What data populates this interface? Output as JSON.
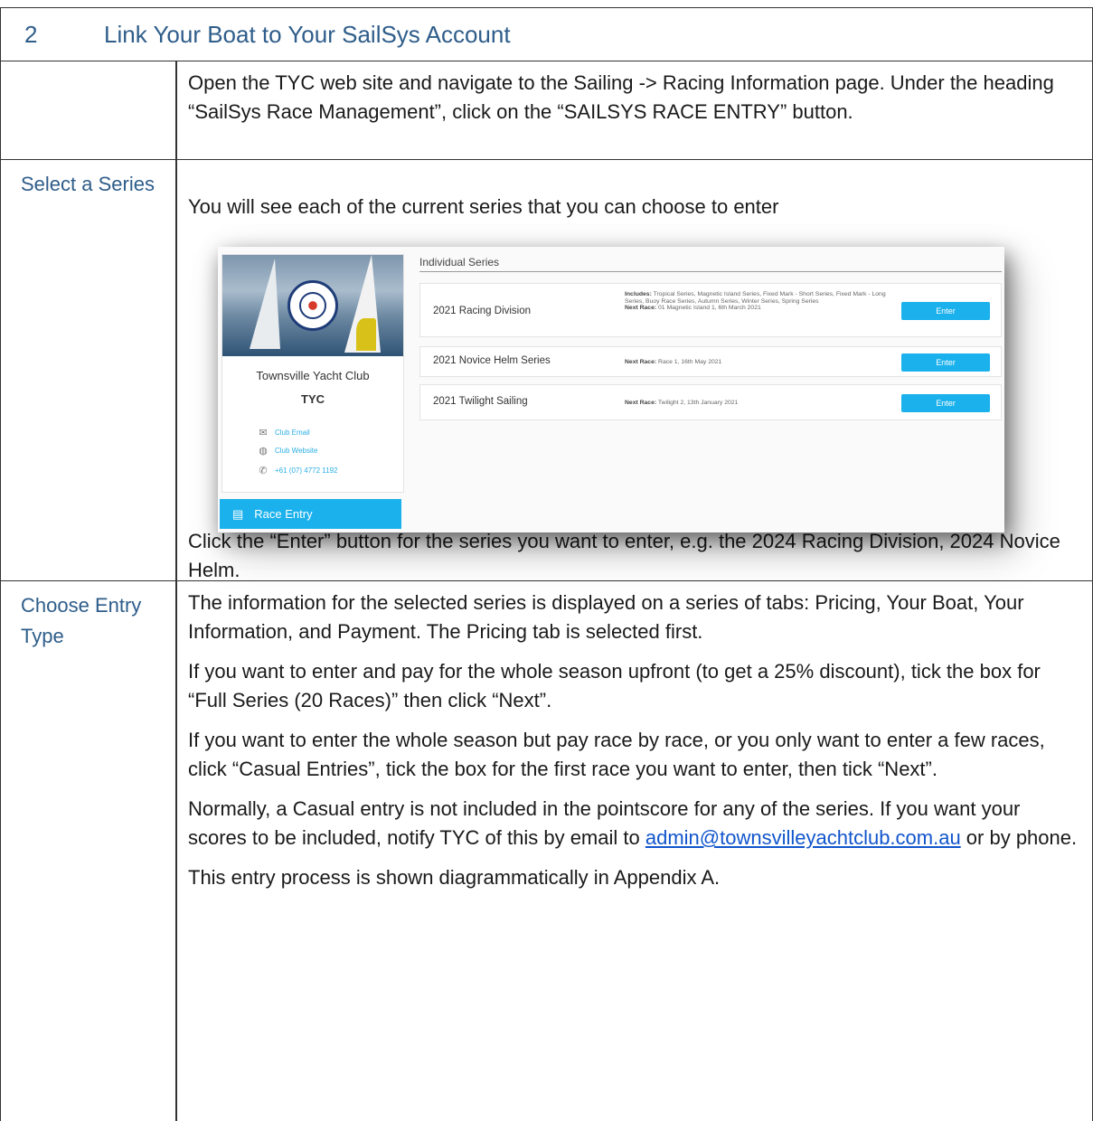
{
  "section": {
    "number": "2",
    "title": "Link Your Boat to Your SailSys Account"
  },
  "row1": {
    "label": "",
    "text": "Open the TYC web site and navigate to the Sailing -> Racing Information page. Under the heading “SailSys Race Management”, click on the “SAILSYS RACE ENTRY” button."
  },
  "row2": {
    "label": "Select a Series",
    "intro": "You will see each of the current series that you can choose to enter",
    "outro": "Click the “Enter” button for the series you want to enter, e.g. the 2024 Racing Division, 2024 Novice Helm."
  },
  "screenshot": {
    "club_name": "Townsville Yacht Club",
    "club_abbr": "TYC",
    "links": [
      {
        "icon": "envelope-icon",
        "label": "Club Email"
      },
      {
        "icon": "globe-icon",
        "label": "Club Website"
      },
      {
        "icon": "phone-icon",
        "label": "+61 (07) 4772 1192"
      }
    ],
    "race_entry_label": "Race Entry",
    "section_heading": "Individual Series",
    "series": [
      {
        "name": "2021 Racing Division",
        "includes_label": "Includes:",
        "includes": "Tropical Series, Magnetic Island Series, Fixed Mark - Short Series, Fixed Mark - Long Series, Buoy Race Series, Autumn Series, Winter Series, Spring Series",
        "next_label": "Next Race:",
        "next": "01 Magnetic Island 1, 6th March 2021",
        "button": "Enter"
      },
      {
        "name": "2021 Novice Helm Series",
        "next_label": "Next Race:",
        "next": "Race 1, 16th May 2021",
        "button": "Enter"
      },
      {
        "name": "2021 Twilight Sailing",
        "next_label": "Next Race:",
        "next": "Twilight 2, 13th January 2021",
        "button": "Enter"
      }
    ]
  },
  "row3": {
    "label": "Choose Entry Type",
    "p1": "The information for the selected series is displayed on a series of tabs: Pricing, Your Boat, Your Information, and Payment.  The Pricing tab is selected first.",
    "p2": "If you want to enter and pay for the whole season upfront (to get a 25% discount), tick the box for “Full Series (20 Races)” then click “Next”.",
    "p3": "If you want to enter the whole season but pay race by race, or you only want to enter a few races, click “Casual Entries”, tick the box for the first race you want to enter, then tick “Next”.",
    "p4_before": "Normally, a Casual entry is not included in the pointscore for any of the series.  If you want your scores to be included, notify TYC of this by email to",
    "p4_email": "admin@townsvilleyachtclub.com.au",
    "p4_after": " or by phone.",
    "p5": "This entry process is shown diagrammatically in Appendix A."
  }
}
